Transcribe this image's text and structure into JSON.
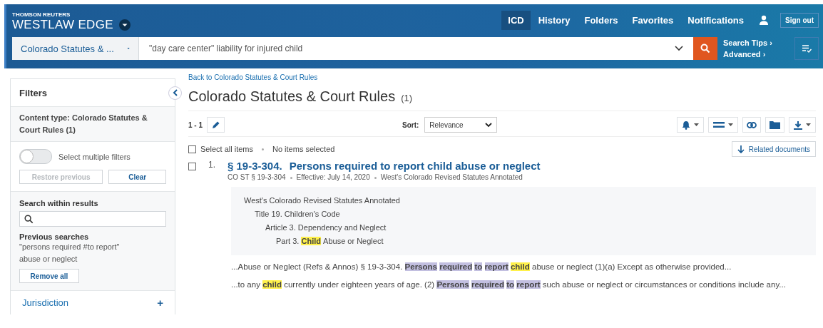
{
  "header": {
    "brand_top": "THOMSON REUTERS",
    "brand": "WESTLAW EDGE",
    "nav": [
      {
        "label": "ICD",
        "selected": true
      },
      {
        "label": "History",
        "selected": false
      },
      {
        "label": "Folders",
        "selected": false
      },
      {
        "label": "Favorites",
        "selected": false
      },
      {
        "label": "Notifications",
        "selected": false
      }
    ],
    "sign_out": "Sign out"
  },
  "search": {
    "scope": "Colorado Statutes & ...",
    "query": "\"day care center\" liability for injured child",
    "search_tips": "Search Tips ›",
    "advanced": "Advanced ›"
  },
  "filters": {
    "title": "Filters",
    "content_type": "Content type: Colorado Statutes & Court Rules (1)",
    "toggle": {
      "label": "Select multiple filters",
      "on": false
    },
    "restore": {
      "label": "Restore previous",
      "disabled": true
    },
    "clear": {
      "label": "Clear",
      "disabled": false
    },
    "search_within": "Search within results",
    "previous_title": "Previous searches",
    "previous_query": "\"persons required #to report\" abuse or neglect",
    "remove_all": "Remove all",
    "jurisdiction": "Jurisdiction",
    "jurisdiction_toggle": "+"
  },
  "main": {
    "back_link": "Back to Colorado Statutes & Court Rules",
    "title": "Colorado Statutes & Court Rules",
    "count": "(1)",
    "range": "1 - 1",
    "sort_label": "Sort:",
    "sort_value": "Relevance",
    "select_all": {
      "label": "Select all items",
      "checked": false
    },
    "selection_status": "No items selected",
    "related": "Related documents",
    "results": [
      {
        "checked": false,
        "number": "1.",
        "section": "§ 19-3-304.",
        "title": "Persons required to report child abuse or neglect",
        "citation": [
          "CO ST § 19-3-304",
          "Effective: July 14, 2020",
          "West's Colorado Revised Statutes Annotated"
        ],
        "hierarchy": [
          {
            "segments": [
              {
                "kind": "text",
                "text": "West's Colorado Revised Statutes Annotated"
              }
            ],
            "children": [
              {
                "segments": [
                  {
                    "kind": "text",
                    "text": "Title 19. Children's Code"
                  }
                ],
                "children": [
                  {
                    "segments": [
                      {
                        "kind": "text",
                        "text": "Article 3. Dependency and Neglect"
                      }
                    ],
                    "children": [
                      {
                        "segments": [
                          {
                            "kind": "text",
                            "text": "Part 3."
                          },
                          {
                            "kind": "hit",
                            "text": "Child"
                          },
                          {
                            "kind": "text",
                            "text": "Abuse or Neglect"
                          }
                        ]
                      }
                    ]
                  }
                ]
              }
            ]
          }
        ],
        "snippets": [
          [
            {
              "kind": "text",
              "text": "...Abuse or Neglect (Refs & Annos) §  19-3-304."
            },
            {
              "kind": "term",
              "text": "Persons"
            },
            {
              "kind": "term",
              "text": "required"
            },
            {
              "kind": "term",
              "text": "to"
            },
            {
              "kind": "term",
              "text": "report"
            },
            {
              "kind": "hit",
              "text": "child"
            },
            {
              "kind": "text",
              "text": "abuse or neglect (1)(a)  Except as otherwise provided..."
            }
          ],
          [
            {
              "kind": "text",
              "text": "...to any"
            },
            {
              "kind": "hit",
              "text": "child"
            },
            {
              "kind": "text",
              "text": "currently under eighteen years of age. (2)"
            },
            {
              "kind": "term",
              "text": "Persons"
            },
            {
              "kind": "term",
              "text": "required"
            },
            {
              "kind": "term",
              "text": "to"
            },
            {
              "kind": "term",
              "text": "report"
            },
            {
              "kind": "text",
              "text": "such abuse or neglect or circumstances or conditions include any..."
            }
          ]
        ]
      }
    ]
  }
}
